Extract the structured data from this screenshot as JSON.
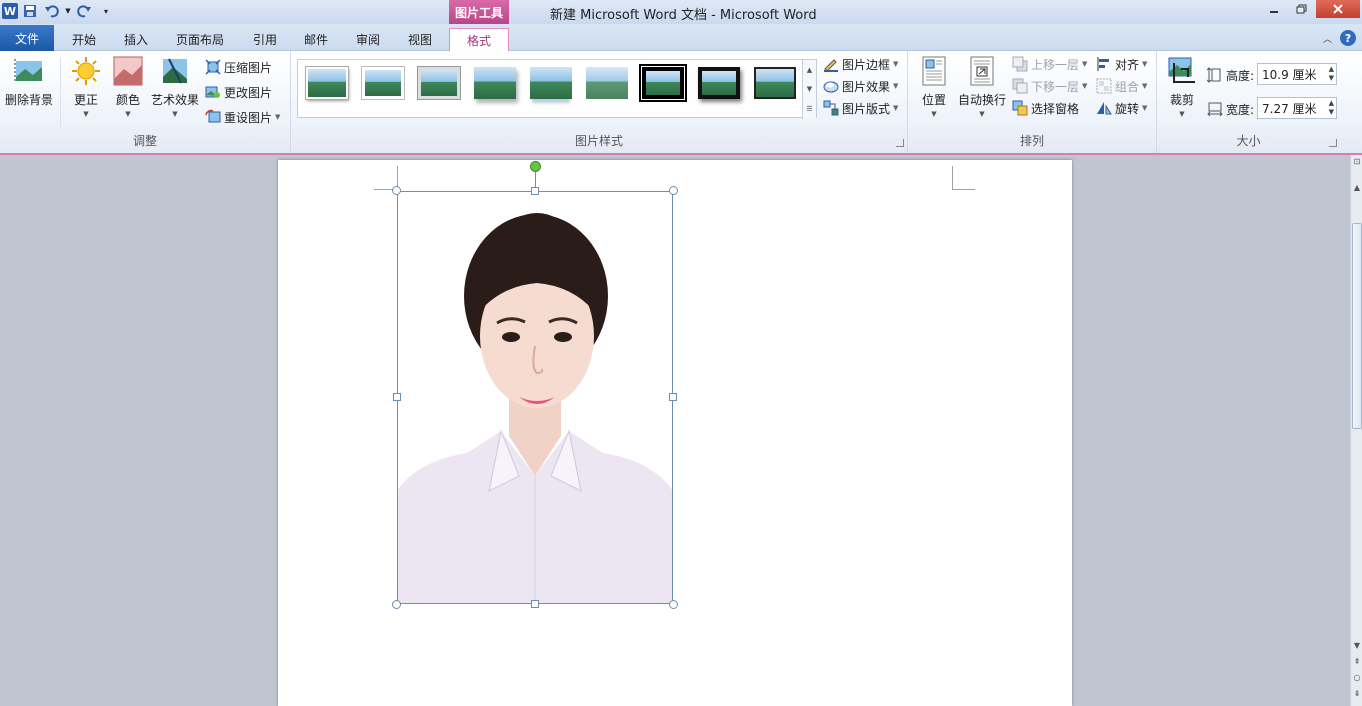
{
  "titlebar": {
    "title": "新建 Microsoft Word 文档  -  Microsoft Word",
    "context_tab_head": "图片工具",
    "app_icon": "word-logo-icon"
  },
  "tabs": [
    {
      "label": "文件"
    },
    {
      "label": "开始"
    },
    {
      "label": "插入"
    },
    {
      "label": "页面布局"
    },
    {
      "label": "引用"
    },
    {
      "label": "邮件"
    },
    {
      "label": "审阅"
    },
    {
      "label": "视图"
    },
    {
      "label": "格式"
    }
  ],
  "ribbon": {
    "adjust": {
      "label": "调整",
      "remove_bg": "删除背景",
      "corrections": "更正",
      "color": "颜色",
      "artistic": "艺术效果",
      "compress": "压缩图片",
      "change": "更改图片",
      "reset": "重设图片"
    },
    "styles": {
      "label": "图片样式",
      "border": "图片边框",
      "effects": "图片效果",
      "layout": "图片版式"
    },
    "arrange": {
      "label": "排列",
      "position": "位置",
      "wrap": "自动换行",
      "bring_forward": "上移一层",
      "send_backward": "下移一层",
      "selection_pane": "选择窗格",
      "align": "对齐",
      "group": "组合",
      "rotate": "旋转"
    },
    "size": {
      "label": "大小",
      "crop": "裁剪",
      "height_label": "高度:",
      "height_value": "10.9 厘米",
      "width_label": "宽度:",
      "width_value": "7.27 厘米"
    }
  }
}
